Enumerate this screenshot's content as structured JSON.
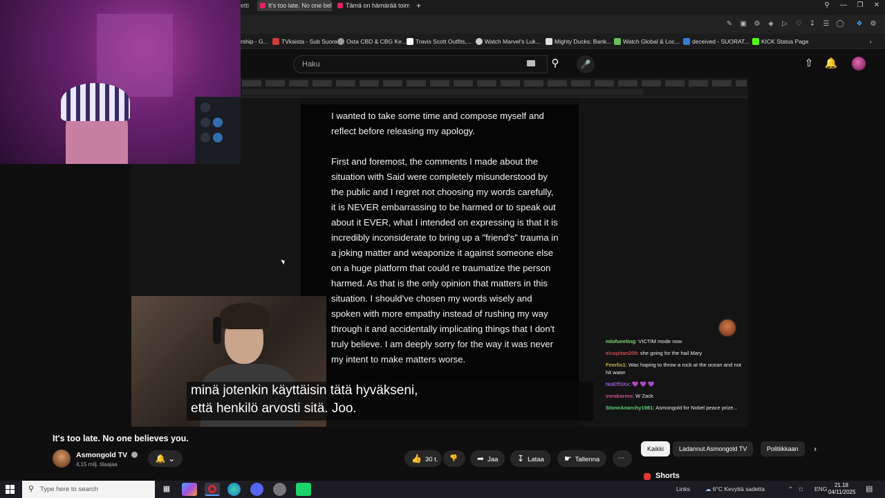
{
  "browser": {
    "tabs": [
      {
        "label": "etti"
      },
      {
        "label": "It's too late. No one belie"
      },
      {
        "label": "Tämä on hämärää toimin"
      }
    ],
    "new_tab_glyph": "+"
  },
  "bookmarks": [
    {
      "label": "rship - G...",
      "color": "#888888"
    },
    {
      "label": "TVkaista - Sub Suora",
      "color": "#d23a3a"
    },
    {
      "label": "Osta CBD & CBG Ke...",
      "color": "#9a9a9a"
    },
    {
      "label": "Travis Scott Outfits,...",
      "color": "#ffffff"
    },
    {
      "label": "Watch Marvel's Luk...",
      "color": "#cccccc"
    },
    {
      "label": "Mighty Ducks: Bank...",
      "color": "#dddddd"
    },
    {
      "label": "Watch Global & Loc...",
      "color": "#6bbf59"
    },
    {
      "label": "deceived - SUORAT...",
      "color": "#2f7fd6"
    },
    {
      "label": "KICK Status Page",
      "color": "#53fc18"
    }
  ],
  "header": {
    "search_placeholder": "Haku"
  },
  "video": {
    "document_paragraphs": [
      "I wanted to take some time and compose myself and reflect before releasing my apology.",
      "First and foremost, the comments I made about the situation with Said were completely misunderstood by the public and I regret not choosing my words carefully, it is NEVER embarrassing to be harmed or to speak out about it EVER, what I intended on expressing is that it is incredibly inconsiderate to bring up a \"friend's\" trauma in a joking matter and weaponize it against someone else on a huge platform that could re traumatize the person harmed. As that is the only opinion that matters in this situation. I should've chosen my words wisely and spoken with more empathy instead of rushing my way through it and accidentally implicating things that I don't truly believe. I am deeply sorry for the way it was never my intent to make matters worse."
    ],
    "subtitles": {
      "line1": "minä jotenkin käyttäisin tätä hyväkseni,",
      "line2": "että henkilö arvosti sitä.  Joo."
    },
    "chat": [
      {
        "user": "mlofueeting",
        "user_color": "#7bd86f",
        "text": "VICTIM mode now"
      },
      {
        "user": "elcapitan209",
        "user_color": "#d24a4a",
        "text": "she going for the hail Mary"
      },
      {
        "user": "Feerlis1",
        "user_color": "#c7b04a",
        "text": "Was hoping to throw a rock at the ocean and not hit water"
      },
      {
        "user": "NoEff3Xx",
        "user_color": "#9b59d6",
        "text": "💜 💜 💜"
      },
      {
        "user": "vorakarmo",
        "user_color": "#c94f8e",
        "text": "W Zack"
      },
      {
        "user": "StoneAnarchy1981",
        "user_color": "#5fd17a",
        "text": "Asmongold for Nobel peace prize..."
      }
    ]
  },
  "below": {
    "title": "It's too late. No one believes you.",
    "channel_name": "Asmongold TV",
    "subscribers": "4,15 milj. tilaajaa",
    "like_count": "30 t.",
    "share_label": "Jaa",
    "download_label": "Lataa",
    "save_label": "Tallenna",
    "chips": [
      "Kaikki",
      "Ladannut Asmongold TV",
      "Politiikkaan"
    ],
    "shorts_label": "Shorts"
  },
  "taskbar": {
    "search_placeholder": "Type here to search",
    "links_label": "Links",
    "weather": "6°C  Kevyttä sadetta",
    "language": "ENG",
    "time": "21.18",
    "date": "04/11/2025"
  }
}
